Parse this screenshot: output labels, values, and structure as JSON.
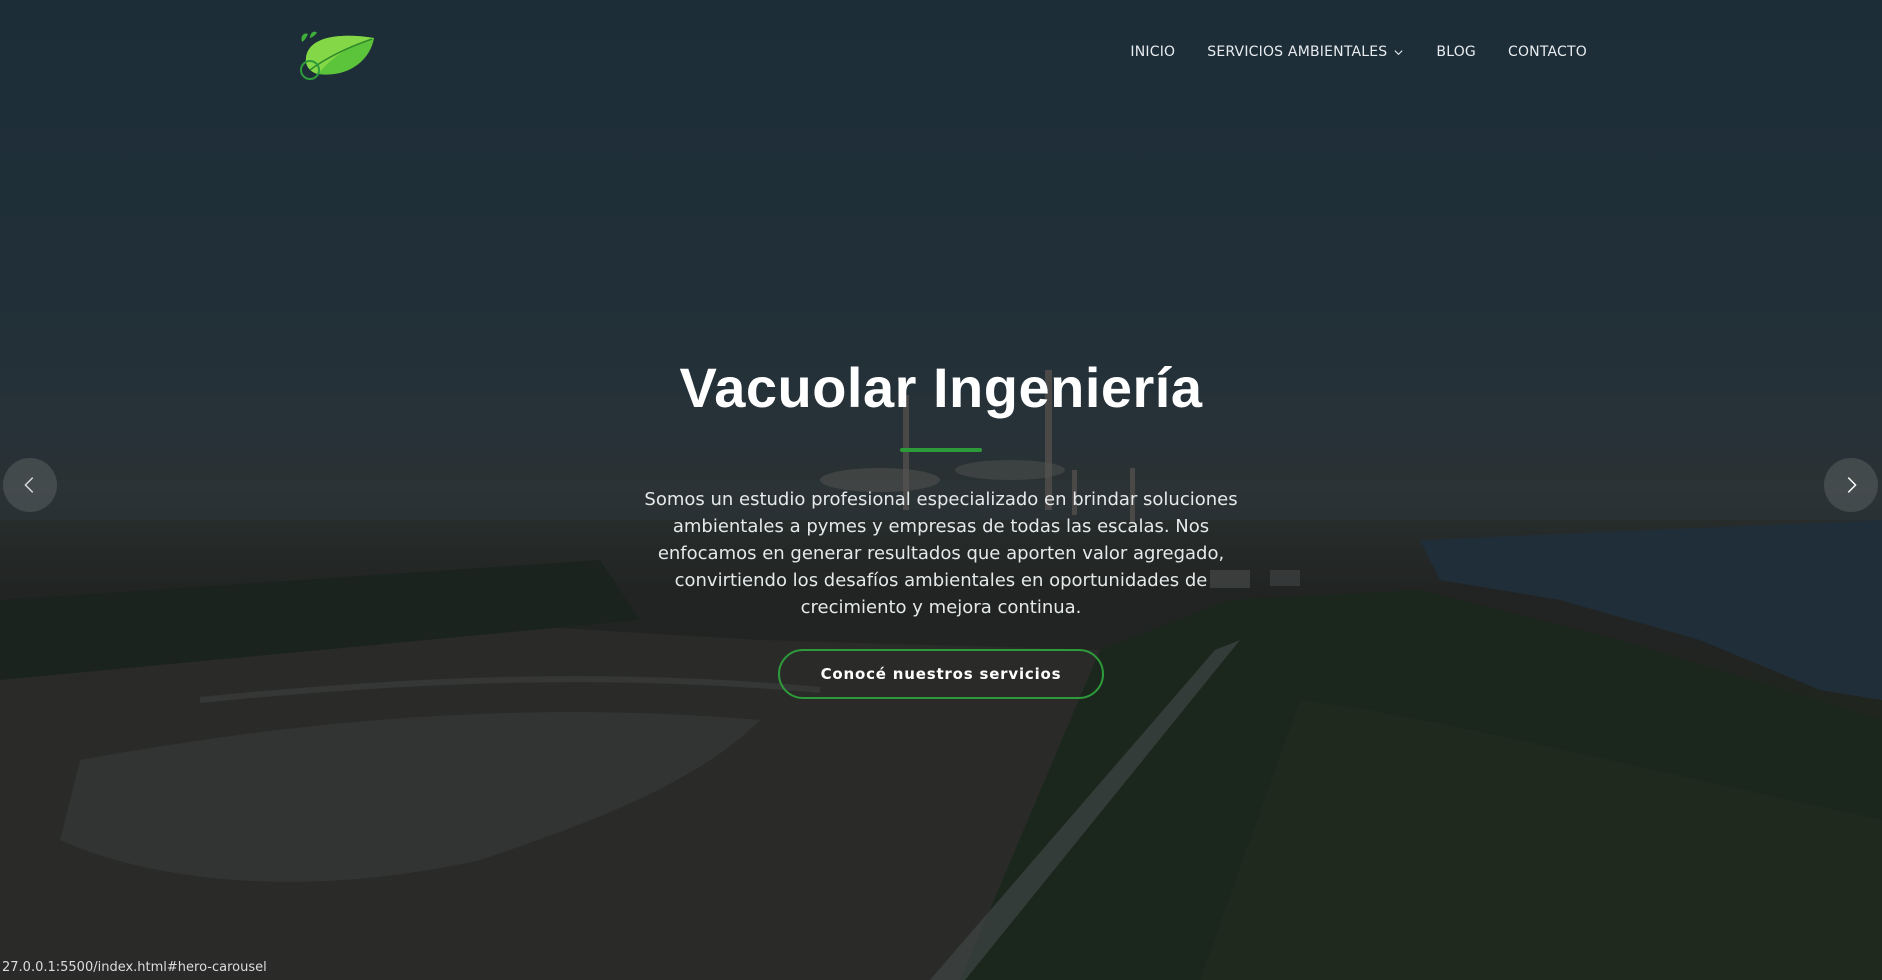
{
  "header": {
    "logo_alt": "Vacuolar Ingeniería logo",
    "nav": [
      {
        "label": "INICIO"
      },
      {
        "label": "SERVICIOS AMBIENTALES",
        "has_dropdown": true
      },
      {
        "label": "BLOG"
      },
      {
        "label": "CONTACTO"
      }
    ]
  },
  "hero": {
    "title": "Vacuolar Ingeniería",
    "description": "Somos un estudio profesional especializado en brindar soluciones ambientales a pymes y empresas de todas las escalas. Nos enfocamos en generar resultados que aporten valor agregado, convirtiendo los desafíos ambientales en oportunidades de crecimiento y mejora continua.",
    "cta_label": "Conocé nuestros servicios"
  },
  "carousel": {
    "prev_icon": "chevron-left-icon",
    "next_icon": "chevron-right-icon"
  },
  "status_bar": {
    "url": "27.0.0.1:5500/index.html#hero-carousel"
  },
  "colors": {
    "accent_green": "#2e9b3a",
    "text_white": "#ffffff"
  }
}
